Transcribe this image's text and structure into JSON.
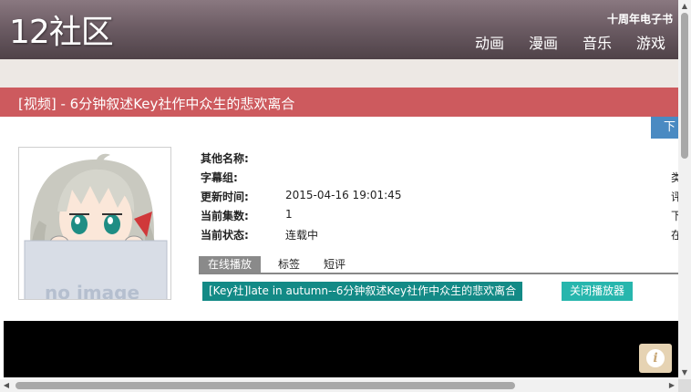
{
  "header": {
    "logo": "12社区",
    "anniversary": "十周年电子书",
    "nav": [
      "动画",
      "漫画",
      "音乐",
      "游戏"
    ]
  },
  "page_title": "[视频] - 6分钟叙述Key社作中众生的悲欢离合",
  "download_tab": "下",
  "info": {
    "rows": [
      {
        "key": "其他名称:",
        "value": ""
      },
      {
        "key": "字幕组:",
        "value": ""
      },
      {
        "key": "更新时间:",
        "value": "2015-04-16 19:01:45"
      },
      {
        "key": "当前集数:",
        "value": "1"
      },
      {
        "key": "当前状态:",
        "value": "连载中"
      }
    ],
    "right_col": [
      "类",
      "评",
      "下",
      "在"
    ]
  },
  "tabs": [
    "在线播放",
    "标签",
    "短评"
  ],
  "episode_button": "[Key社]late in autumn--6分钟叙述Key社作中众生的悲欢离合",
  "close_player_button": "关闭播放器",
  "poster_watermark": "no image",
  "colors": {
    "header": "#6d5d65",
    "title_bar": "#cd5a5e",
    "episode_button": "#138a86",
    "close_button": "#27b6ad"
  }
}
